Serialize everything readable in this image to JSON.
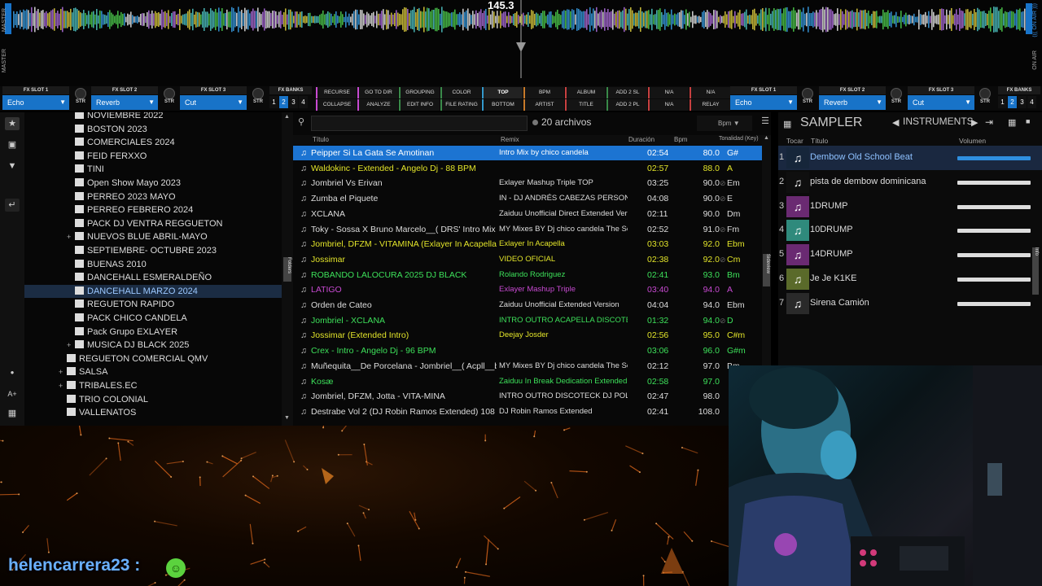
{
  "deck": {
    "bpm_display": "145.3",
    "master_label": "MASTER",
    "on_air_label": "ON AIR",
    "on_air_label_left": "((( ON AIR )))"
  },
  "fx_left": {
    "slot1": {
      "title": "FX SLOT 1",
      "value": "Echo"
    },
    "slot2": {
      "title": "FX SLOT 2",
      "value": "Reverb"
    },
    "slot3": {
      "title": "FX SLOT 3",
      "value": "Cut"
    },
    "str_label": "STR",
    "banks_title": "FX BANKS",
    "banks": [
      "1",
      "2",
      "3",
      "4"
    ]
  },
  "fx_right": {
    "slot1": {
      "title": "FX SLOT 1",
      "value": "Echo"
    },
    "slot2": {
      "title": "FX SLOT 2",
      "value": "Reverb"
    },
    "slot3": {
      "title": "FX SLOT 3",
      "value": "Cut"
    },
    "str_label": "STR",
    "banks_title": "FX BANKS",
    "banks": [
      "1",
      "2",
      "3",
      "4"
    ]
  },
  "sort_buttons": [
    "RECURSE",
    "GO TO DIR",
    "GROUPING",
    "COLOR",
    "TOP",
    "BPM",
    "ALBUM",
    "ADD 2 SL",
    "N/A",
    "N/A",
    "COLLAPSE",
    "ANALYZE",
    "EDIT INFO",
    "FILE RATING",
    "BOTTOM",
    "ARTIST",
    "TITLE",
    "ADD 2 PL",
    "N/A",
    "RELAY"
  ],
  "folders": [
    {
      "name": "NOVIEMBRE 2022",
      "indent": 1,
      "plus": false
    },
    {
      "name": "BOSTON 2023",
      "indent": 1,
      "plus": false
    },
    {
      "name": "COMERCIALES 2024",
      "indent": 1,
      "plus": false
    },
    {
      "name": "FEID FERXXO",
      "indent": 1,
      "plus": false
    },
    {
      "name": "TINI",
      "indent": 1,
      "plus": false
    },
    {
      "name": "Open Show Mayo 2023",
      "indent": 1,
      "plus": false
    },
    {
      "name": "PERREO 2023 MAYO",
      "indent": 1,
      "plus": false
    },
    {
      "name": "PERREO FEBRERO 2024",
      "indent": 1,
      "plus": false
    },
    {
      "name": "PACK DJ VENTRA REGGUETON",
      "indent": 1,
      "plus": false
    },
    {
      "name": "NUEVOS BLUE ABRIL-MAYO",
      "indent": 1,
      "plus": true
    },
    {
      "name": "SEPTIEMBRE- OCTUBRE 2023",
      "indent": 1,
      "plus": false
    },
    {
      "name": "BUENAS 2010",
      "indent": 1,
      "plus": false
    },
    {
      "name": "DANCEHALL ESMERALDEÑO",
      "indent": 1,
      "plus": false
    },
    {
      "name": "DANCEHALL MARZO 2024",
      "indent": 1,
      "plus": false,
      "selected": true
    },
    {
      "name": "REGUETON RAPIDO",
      "indent": 1,
      "plus": false
    },
    {
      "name": "PACK CHICO CANDELA",
      "indent": 1,
      "plus": false
    },
    {
      "name": "Pack Grupo EXLAYER",
      "indent": 1,
      "plus": false
    },
    {
      "name": "MUSICA DJ BLACK 2025",
      "indent": 1,
      "plus": true
    },
    {
      "name": "REGUETON COMERCIAL QMV",
      "indent": 0,
      "plus": false
    },
    {
      "name": "SALSA",
      "indent": 0,
      "plus": true
    },
    {
      "name": "TRIBALES.EC",
      "indent": 0,
      "plus": true
    },
    {
      "name": "TRIO COLONIAL",
      "indent": 0,
      "plus": false
    },
    {
      "name": "VALLENATOS",
      "indent": 0,
      "plus": false
    }
  ],
  "browser": {
    "file_count": "20 archivos",
    "bpm_sort": "Bpm",
    "headers": {
      "title": "Título",
      "remix": "Remix",
      "duration": "Duración",
      "bpm": "Bpm",
      "key": "Tonalidad (Key)"
    }
  },
  "tracks": [
    {
      "title": "Peipper  Si La Gata Se Amotinan",
      "remix": "Intro Mix by chico candela",
      "duration": "02:54",
      "bpm": "80.0",
      "key": "G#",
      "color": "sel",
      "check": false
    },
    {
      "title": "Waldokinc - Extended - Angelo Dj - 88 BPM",
      "remix": "",
      "duration": "02:57",
      "bpm": "88.0",
      "key": "A",
      "color": "y",
      "check": false
    },
    {
      "title": "Jombriel Vs Erivan",
      "remix": "Exlayer Mashup Triple  TOP",
      "duration": "03:25",
      "bpm": "90.0",
      "key": "Em",
      "color": "w",
      "check": true
    },
    {
      "title": "Zumba el Piquete",
      "remix": "IN - DJ ANDRÉS CABEZAS PERSONAL EDIT",
      "duration": "04:08",
      "bpm": "90.0",
      "key": "E",
      "color": "w",
      "check": true
    },
    {
      "title": "XCLANA",
      "remix": "Zaiduu Unofficial Direct Extended Version",
      "duration": "02:11",
      "bpm": "90.0",
      "key": "Dm",
      "color": "w",
      "check": false
    },
    {
      "title": "Toky - Sossa X Bruno Marcelo__( DRS' Intro Mix by chico candela )",
      "remix": "MY Mixes BY  Dj chico candela  The School 0...",
      "duration": "02:52",
      "bpm": "91.0",
      "key": "Fm",
      "color": "w",
      "check": true
    },
    {
      "title": "Jombriel, DFZM - VITAMINA (Exlayer In Acapella)",
      "remix": "Exlayer In Acapella",
      "duration": "03:03",
      "bpm": "92.0",
      "key": "Ebm",
      "color": "y",
      "check": false
    },
    {
      "title": "Jossimar",
      "remix": "VIDEO OFICIAL",
      "duration": "02:38",
      "bpm": "92.0",
      "key": "Cm",
      "color": "y",
      "check": true
    },
    {
      "title": "ROBANDO LALOCURA 2025 DJ BLACK",
      "remix": "Rolando Rodriguez",
      "duration": "02:41",
      "bpm": "93.0",
      "key": "Bm",
      "color": "g",
      "check": false
    },
    {
      "title": "LATIGO",
      "remix": "Exlayer Mashup Triple",
      "duration": "03:40",
      "bpm": "94.0",
      "key": "A",
      "color": "m",
      "check": false
    },
    {
      "title": "Orden de Cateo",
      "remix": "Zaiduu Unofficial Extended Version",
      "duration": "04:04",
      "bpm": "94.0",
      "key": "Ebm",
      "color": "w",
      "check": false
    },
    {
      "title": "Jombriel - XCLANA",
      "remix": "INTRO OUTRO ACAPELLA DISCOTECK DJ...",
      "duration": "01:32",
      "bpm": "94.0",
      "key": "D",
      "color": "g",
      "check": true
    },
    {
      "title": "Jossimar (Extended Intro)",
      "remix": "Deejay Josder",
      "duration": "02:56",
      "bpm": "95.0",
      "key": "C#m",
      "color": "y",
      "check": false
    },
    {
      "title": "Crex - Intro - Angelo Dj - 96 BPM",
      "remix": "",
      "duration": "03:06",
      "bpm": "96.0",
      "key": "G#m",
      "color": "g",
      "check": false
    },
    {
      "title": "Muñequita__De Porcelana - Jombriel__( Acpll__by chico candela )",
      "remix": "MY Mixes BY  Dj chico candela  The School 0...",
      "duration": "02:12",
      "bpm": "97.0",
      "key": "Bm",
      "color": "w",
      "check": false
    },
    {
      "title": "Kosæ",
      "remix": "Zaiduu In Break Dedication Extended",
      "duration": "02:58",
      "bpm": "97.0",
      "key": "",
      "color": "g",
      "check": false
    },
    {
      "title": "Jombriel, DFZM, Jotta - VITA-MINA",
      "remix": "INTRO OUTRO DISCOTECK DJ POLIMIX FT...",
      "duration": "02:47",
      "bpm": "98.0",
      "key": "",
      "color": "w",
      "check": false
    },
    {
      "title": "Destrabe Vol 2 (DJ Robin Ramos Extended) 108 Bpm",
      "remix": "DJ Robin Ramos Extended",
      "duration": "02:41",
      "bpm": "108.0",
      "key": "",
      "color": "w",
      "check": false
    }
  ],
  "sampler": {
    "title": "SAMPLER",
    "bank": "INSTRUMENTS",
    "headers": {
      "play": "Tocar",
      "title": "Título",
      "volume": "Volumen"
    },
    "items": [
      {
        "n": "1",
        "name": "Dembow Old School Beat",
        "pad": "#16263a",
        "selected": true,
        "vol": 1.0
      },
      {
        "n": "2",
        "name": "pista de dembow dominicana",
        "pad": "#0f0f0f",
        "selected": false,
        "vol": 1.0
      },
      {
        "n": "3",
        "name": "1DRUMP",
        "pad": "#6a2a72",
        "selected": false,
        "vol": 1.0
      },
      {
        "n": "4",
        "name": "10DRUMP",
        "pad": "#2f8a7c",
        "selected": false,
        "vol": 1.0
      },
      {
        "n": "5",
        "name": "14DRUMP",
        "pad": "#6a2a72",
        "selected": false,
        "vol": 1.0
      },
      {
        "n": "6",
        "name": "Je Je K1KE",
        "pad": "#5a6a2a",
        "selected": false,
        "vol": 1.0
      },
      {
        "n": "7",
        "name": "Sirena Camión",
        "pad": "#2a2a2a",
        "selected": false,
        "vol": 1.0
      }
    ]
  },
  "side_tabs": {
    "left": "Folders",
    "mid": "Sideview",
    "right": "Info"
  },
  "chat": {
    "user": "helencarrera23 :"
  },
  "colors": {
    "accent": "#1873c8",
    "selected_row": "#1c74d2",
    "yellow": "#e2e42a",
    "green": "#3de05a",
    "magenta": "#c84ad2"
  },
  "icons": [
    "search-icon",
    "music-note-icon",
    "folder-icon",
    "star-icon",
    "filter-icon",
    "back-icon",
    "grid-icon",
    "arrow-left-icon",
    "arrow-right-icon",
    "emoji-icon",
    "webcam-feed"
  ]
}
